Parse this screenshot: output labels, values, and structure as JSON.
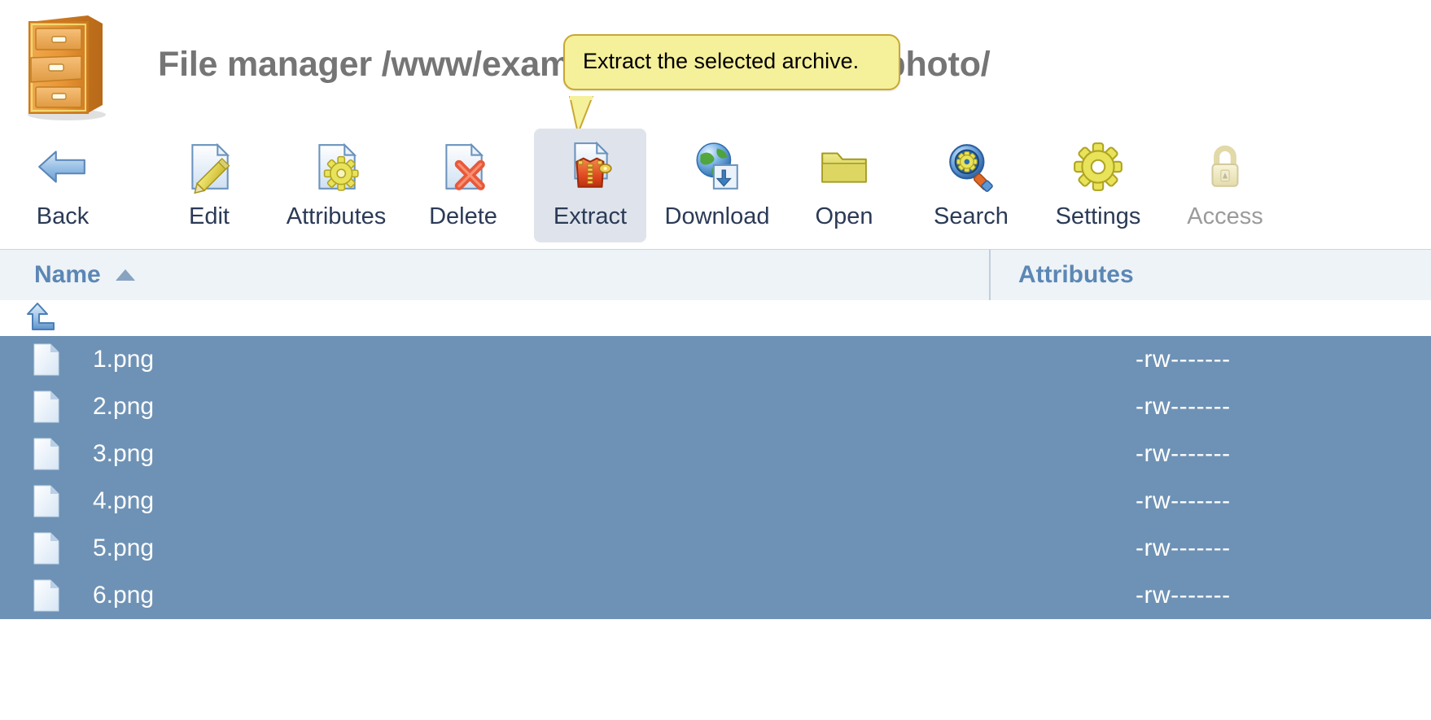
{
  "header": {
    "title": "File manager /www/example.s.net/photo.zip/photo/",
    "title_visible_left": "File manager /www/exam",
    "title_visible_right": "s.net/photo.zip/photo/",
    "cabinet_icon": "file-cabinet-icon"
  },
  "tooltip": {
    "text": "Extract the selected archive.",
    "background": "#f5f09a",
    "border": "#c9a833",
    "anchored_to": "Extract"
  },
  "toolbar": {
    "selected_index": 4,
    "buttons": [
      {
        "label": "Back",
        "icon": "back-arrow-icon",
        "enabled": true,
        "selected": false
      },
      {
        "label": "Edit",
        "icon": "edit-pencil-icon",
        "enabled": true,
        "selected": false
      },
      {
        "label": "Attributes",
        "icon": "file-gear-icon",
        "enabled": true,
        "selected": false
      },
      {
        "label": "Delete",
        "icon": "file-delete-icon",
        "enabled": true,
        "selected": false
      },
      {
        "label": "Extract",
        "icon": "file-extract-icon",
        "enabled": true,
        "selected": true
      },
      {
        "label": "Download",
        "icon": "globe-download-icon",
        "enabled": true,
        "selected": false
      },
      {
        "label": "Open",
        "icon": "folder-open-icon",
        "enabled": true,
        "selected": false
      },
      {
        "label": "Search",
        "icon": "search-gear-icon",
        "enabled": true,
        "selected": false
      },
      {
        "label": "Settings",
        "icon": "gear-icon",
        "enabled": true,
        "selected": false
      },
      {
        "label": "Access",
        "icon": "lock-icon",
        "enabled": false,
        "selected": false
      }
    ]
  },
  "table": {
    "columns": {
      "name": "Name",
      "attributes": "Attributes"
    },
    "sort": {
      "column": "Name",
      "direction": "ascending",
      "glyph": "sort-asc-icon"
    },
    "parent_row": {
      "icon": "up-directory-icon",
      "name": "",
      "attributes": ""
    },
    "rows": [
      {
        "icon": "file-icon",
        "name": "1.png",
        "attributes": "-rw-------",
        "selected": true
      },
      {
        "icon": "file-icon",
        "name": "2.png",
        "attributes": "-rw-------",
        "selected": true
      },
      {
        "icon": "file-icon",
        "name": "3.png",
        "attributes": "-rw-------",
        "selected": true
      },
      {
        "icon": "file-icon",
        "name": "4.png",
        "attributes": "-rw-------",
        "selected": true
      },
      {
        "icon": "file-icon",
        "name": "5.png",
        "attributes": "-rw-------",
        "selected": true
      },
      {
        "icon": "file-icon",
        "name": "6.png",
        "attributes": "-rw-------",
        "selected": true
      }
    ]
  },
  "colors": {
    "selection_blue": "#6e92b5",
    "header_blue": "#5b87b5",
    "header_bg": "#eef3f7",
    "title_gray": "#757575",
    "tooltip_yellow": "#f5f09a",
    "toolbar_selected_bg": "#dfe4ec",
    "disabled_gray": "#9b9b9b"
  }
}
